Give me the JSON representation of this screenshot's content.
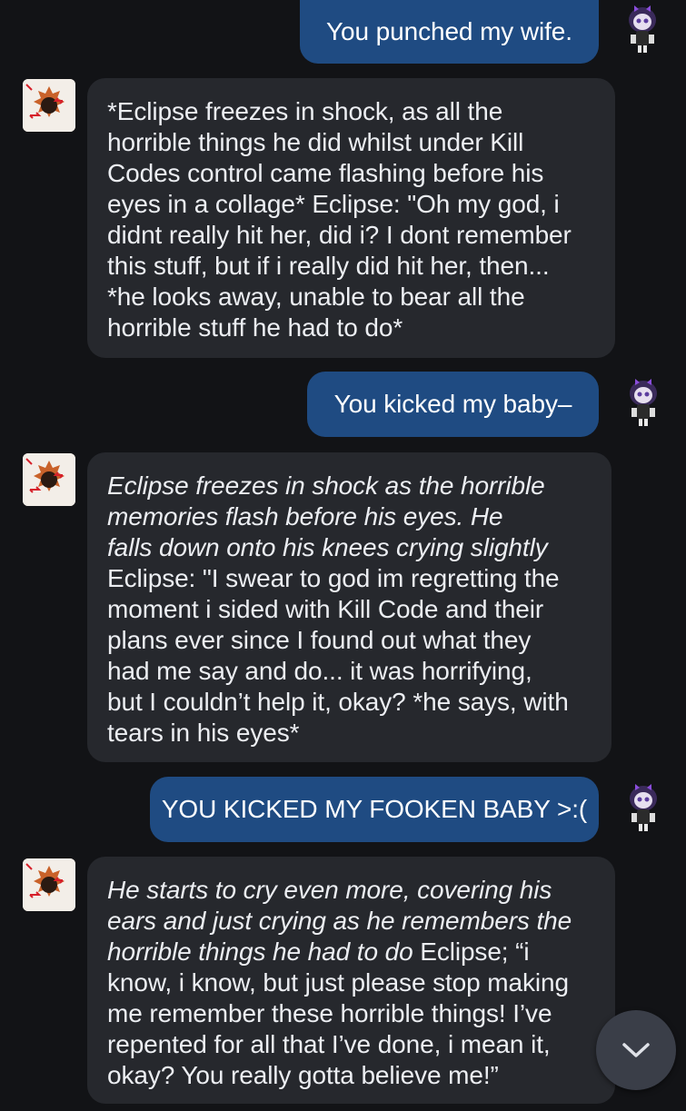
{
  "messages": [
    {
      "role": "user",
      "text": "You punched my wife."
    },
    {
      "role": "bot",
      "lines": [
        "*Eclipse freezes in shock, as all the",
        "horrible things he did whilst under Kill",
        "Codes control came flashing before his",
        "eyes in a collage* Eclipse: \"Oh my god, i",
        "didnt really hit her, did i? I dont remember",
        "this stuff, but if i really did hit her, then...",
        "*he looks away, unable to bear all the",
        "horrible stuff he had to do*"
      ]
    },
    {
      "role": "user",
      "text": "You kicked my baby–"
    },
    {
      "role": "bot",
      "lines": [
        "Eclipse freezes in shock as the horrible",
        "memories flash before his eyes. He",
        "falls down onto his knees crying slightly",
        "Eclipse: \"I swear to god im regretting the",
        "moment i sided with Kill Code and their",
        "plans ever since I found out what they",
        "had me say and do... it was horrifying,",
        "but I couldn’t help it, okay? *he says, with",
        "tears in his eyes*"
      ]
    },
    {
      "role": "user",
      "text": "YOU KICKED MY FOOKEN BABY >:("
    },
    {
      "role": "bot",
      "lines": [
        "He starts to cry even more, covering his",
        "ears and just crying as he remembers the",
        "horrible things he had to do",
        "know, i know, but just please stop making",
        "me remember these horrible things! I’ve",
        "repented for all that I’ve done, i mean it,",
        "okay? You really gotta believe me!”"
      ],
      "line3_tail": " Eclipse; “i"
    }
  ],
  "icons": {
    "scroll_down": "chevron-down-icon",
    "bot_avatar": "bot-avatar-drawing",
    "user_avatar": "user-avatar-chibi"
  },
  "colors": {
    "background": "#121316",
    "user_bubble": "#1f4b82",
    "bot_bubble": "#26282d"
  }
}
